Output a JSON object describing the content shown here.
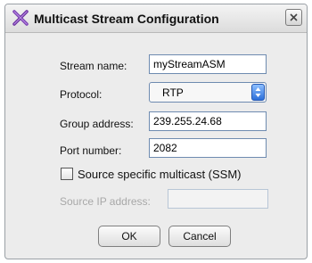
{
  "dialog": {
    "title": "Multicast Stream Configuration",
    "app_icon": "crossed-tools-icon",
    "close_icon": "close-icon"
  },
  "form": {
    "stream_name_label": "Stream name:",
    "stream_name_value": "myStreamASM",
    "protocol_label": "Protocol:",
    "protocol_value": "RTP",
    "group_address_label": "Group address:",
    "group_address_value": "239.255.24.68",
    "port_number_label": "Port number:",
    "port_number_value": "2082",
    "ssm_checkbox_label": "Source specific multicast (SSM)",
    "ssm_checked": false,
    "source_ip_label": "Source IP address:",
    "source_ip_value": ""
  },
  "buttons": {
    "ok_label": "OK",
    "cancel_label": "Cancel"
  },
  "colors": {
    "dialog_background": "#ececec",
    "field_border": "#6e8bb0",
    "stepper_accent": "#2c6fd9",
    "disabled_text": "#a8a8a8"
  }
}
